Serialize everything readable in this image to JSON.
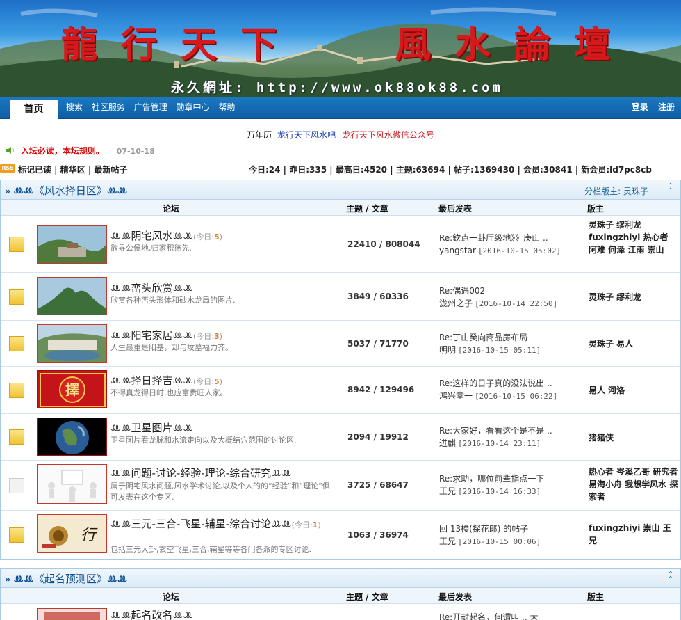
{
  "banner": {
    "title_left": "龍行天下",
    "title_right": "風水論壇",
    "url": "永久網址: http://www.ok88ok88.com"
  },
  "nav": {
    "home": "首页",
    "links": [
      "搜索",
      "社区服务",
      "广告管理",
      "勋章中心",
      "帮助"
    ],
    "login": "登录",
    "register": "注册"
  },
  "links_row": {
    "calendar": "万年历",
    "tieba": "龙行天下风水吧",
    "wechat": "龙行天下风水微信公众号"
  },
  "notice": {
    "message": "入坛必读，本坛规则。",
    "date": "07-10-18"
  },
  "stats_row": {
    "rss": "RSS",
    "quick_links": "标记已读 | 精华区 | 最新帖子",
    "stats": "今日:24 | 昨日:335 | 最高日:4520 | 主题:63694 | 帖子:1369430 | 会员:30841 | 新会员:ld7pc8cb"
  },
  "sections": [
    {
      "title": "《风水择日区》",
      "moderator_label": "分栏版主:",
      "moderator": "灵珠子",
      "columns": {
        "forum": "论坛",
        "counts": "主题 / 文章",
        "last": "最后发表",
        "mods": "版主"
      },
      "forums": [
        {
          "name": "阴宅风水",
          "today_label": "今日:",
          "today": "5",
          "desc": "欲寻公侯地,归家积德先.",
          "counts": "22410 / 808044",
          "last_title": "Re:欽点一卦厅级地》》庚山 ..",
          "last_user": "yangstar",
          "last_time": "[2016-10-15 05:02]",
          "mods": "灵珠子  缪利龙  fuxingzhiyi 热心者  阿难  何泽  江雨  崇山",
          "folder": "new",
          "thumb": "graveyard"
        },
        {
          "name": "峦头欣赏",
          "today_label": "",
          "today": "",
          "desc": "欣赏各种峦头形体和砂水龙局的图片.",
          "counts": "3849 / 60336",
          "last_title": "Re:偶遇002",
          "last_user": "泷州之子",
          "last_time": "[2016-10-14 22:50]",
          "mods": "灵珠子  缪利龙",
          "folder": "new",
          "thumb": "mountain"
        },
        {
          "name": "阳宅家居",
          "today_label": "今日:",
          "today": "3",
          "desc": "人生最重是阳基，却与坟墓福力齐。",
          "counts": "5037 / 71770",
          "last_title": "Re:丁山癸向商品房布局",
          "last_user": "明明",
          "last_time": "[2016-10-15 05:11]",
          "mods": "灵珠子  易人",
          "folder": "new",
          "thumb": "village"
        },
        {
          "name": "择日择吉",
          "today_label": "今日:",
          "today": "5",
          "desc": "不得真龙得日时,也应富贵旺人家。",
          "counts": "8942 / 129496",
          "last_title": "Re:这样的日子真的没法说出 ..",
          "last_user": "鸿兴堂一",
          "last_time": "[2016-10-15 06:22]",
          "mods": "易人  河洛",
          "folder": "new",
          "thumb": "zhai"
        },
        {
          "name": "卫星图片",
          "today_label": "",
          "today": "",
          "desc": "卫星图片看龙脉和水流走向以及大概结穴范围的讨论区.",
          "counts": "2094 / 19912",
          "last_title": "Re:大家好，看看这个是不是 ..",
          "last_user": "进麒",
          "last_time": "[2016-10-14 23:11]",
          "mods": "猪猪侠",
          "folder": "new",
          "thumb": "earth"
        },
        {
          "name": "问题-讨论-经验-理论-综合研究",
          "today_label": "",
          "today": "",
          "desc": "属于阴宅风水问题,风水学术讨论,以及个人的的“经验”和“理论”俱可发表在这个专区.",
          "counts": "3725 / 68647",
          "last_title": "Re:求助，哪位前辈指点一下",
          "last_user": "王兄",
          "last_time": "[2016-10-14 16:33]",
          "mods": "热心者  岑溪乙哥  研究者  易海小舟  我想学风水  探索者",
          "folder": "old",
          "thumb": "people"
        },
        {
          "name": "三元-三合-飞星-辅星-综合讨论",
          "today_label": "今日:",
          "today": "1",
          "desc": "包括三元大卦,玄空飞星,三合,辅星等等各门各派的专区讨论.",
          "counts": "1063 / 36974",
          "last_title": "回 13楼(探花郎) 的帖子",
          "last_user": "王兄",
          "last_time": "[2016-10-15 00:06]",
          "mods": "fuxingzhiyi 崇山  王兄",
          "folder": "new",
          "thumb": "calligraphy"
        }
      ]
    },
    {
      "title": "《起名预测区》",
      "columns": {
        "forum": "论坛",
        "counts": "主题 / 文章",
        "last": "最后发表",
        "mods": "版主"
      },
      "forums": [
        {
          "name": "起名改名",
          "today_label": "",
          "today": "",
          "desc": "",
          "counts": "",
          "last_title": "Re:开封起名，何谓叫 .. 大",
          "last_user": "",
          "last_time": "",
          "mods": "",
          "folder": "new",
          "thumb": "redpaper"
        }
      ]
    }
  ],
  "colors": {
    "nav_blue": "#1468b0",
    "section_title": "#0c4f93",
    "notice_red": "#d00000",
    "link_red": "#c8141b",
    "link_blue": "#1b3fb4",
    "today_orange": "#e67e22"
  }
}
